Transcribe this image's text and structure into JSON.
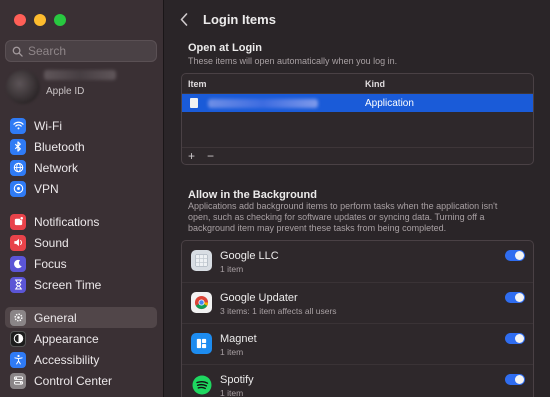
{
  "sidebar": {
    "search_placeholder": "Search",
    "account_label": "Apple ID",
    "items": [
      {
        "label": "Wi-Fi",
        "icon": "wifi-icon",
        "color": "#2f7bf5"
      },
      {
        "label": "Bluetooth",
        "icon": "bluetooth-icon",
        "color": "#2f7bf5"
      },
      {
        "label": "Network",
        "icon": "network-icon",
        "color": "#2f7bf5"
      },
      {
        "label": "VPN",
        "icon": "vpn-icon",
        "color": "#2f7bf5"
      },
      {
        "label": "Notifications",
        "icon": "notifications-icon",
        "color": "#e8434a"
      },
      {
        "label": "Sound",
        "icon": "sound-icon",
        "color": "#e8434a"
      },
      {
        "label": "Focus",
        "icon": "focus-icon",
        "color": "#5b55d6"
      },
      {
        "label": "Screen Time",
        "icon": "screen-time-icon",
        "color": "#5b55d6"
      },
      {
        "label": "General",
        "icon": "gear-icon",
        "color": "#8a8587",
        "selected": true
      },
      {
        "label": "Appearance",
        "icon": "appearance-icon",
        "color": "#1d1d1d"
      },
      {
        "label": "Accessibility",
        "icon": "accessibility-icon",
        "color": "#2f7bf5"
      },
      {
        "label": "Control Center",
        "icon": "control-center-icon",
        "color": "#8a8587"
      }
    ]
  },
  "main": {
    "title": "Login Items",
    "open_at_login": {
      "title": "Open at Login",
      "description": "These items will open automatically when you log in.",
      "columns": {
        "item": "Item",
        "kind": "Kind"
      },
      "rows": [
        {
          "kind": "Application",
          "selected": true
        }
      ],
      "add_label": "+",
      "remove_label": "−"
    },
    "background": {
      "title": "Allow in the Background",
      "description": "Applications add background items to perform tasks when the application isn't open, such as checking for software updates or syncing data. Turning off a background item may prevent these tasks from being completed.",
      "items": [
        {
          "name": "Google LLC",
          "detail": "1 item",
          "enabled": true,
          "icon": "google-llc-icon"
        },
        {
          "name": "Google Updater",
          "detail": "3 items: 1 item affects all users",
          "enabled": true,
          "icon": "chrome-icon"
        },
        {
          "name": "Magnet",
          "detail": "1 item",
          "enabled": true,
          "icon": "magnet-icon"
        },
        {
          "name": "Spotify",
          "detail": "1 item",
          "enabled": true,
          "icon": "spotify-icon"
        }
      ]
    }
  }
}
